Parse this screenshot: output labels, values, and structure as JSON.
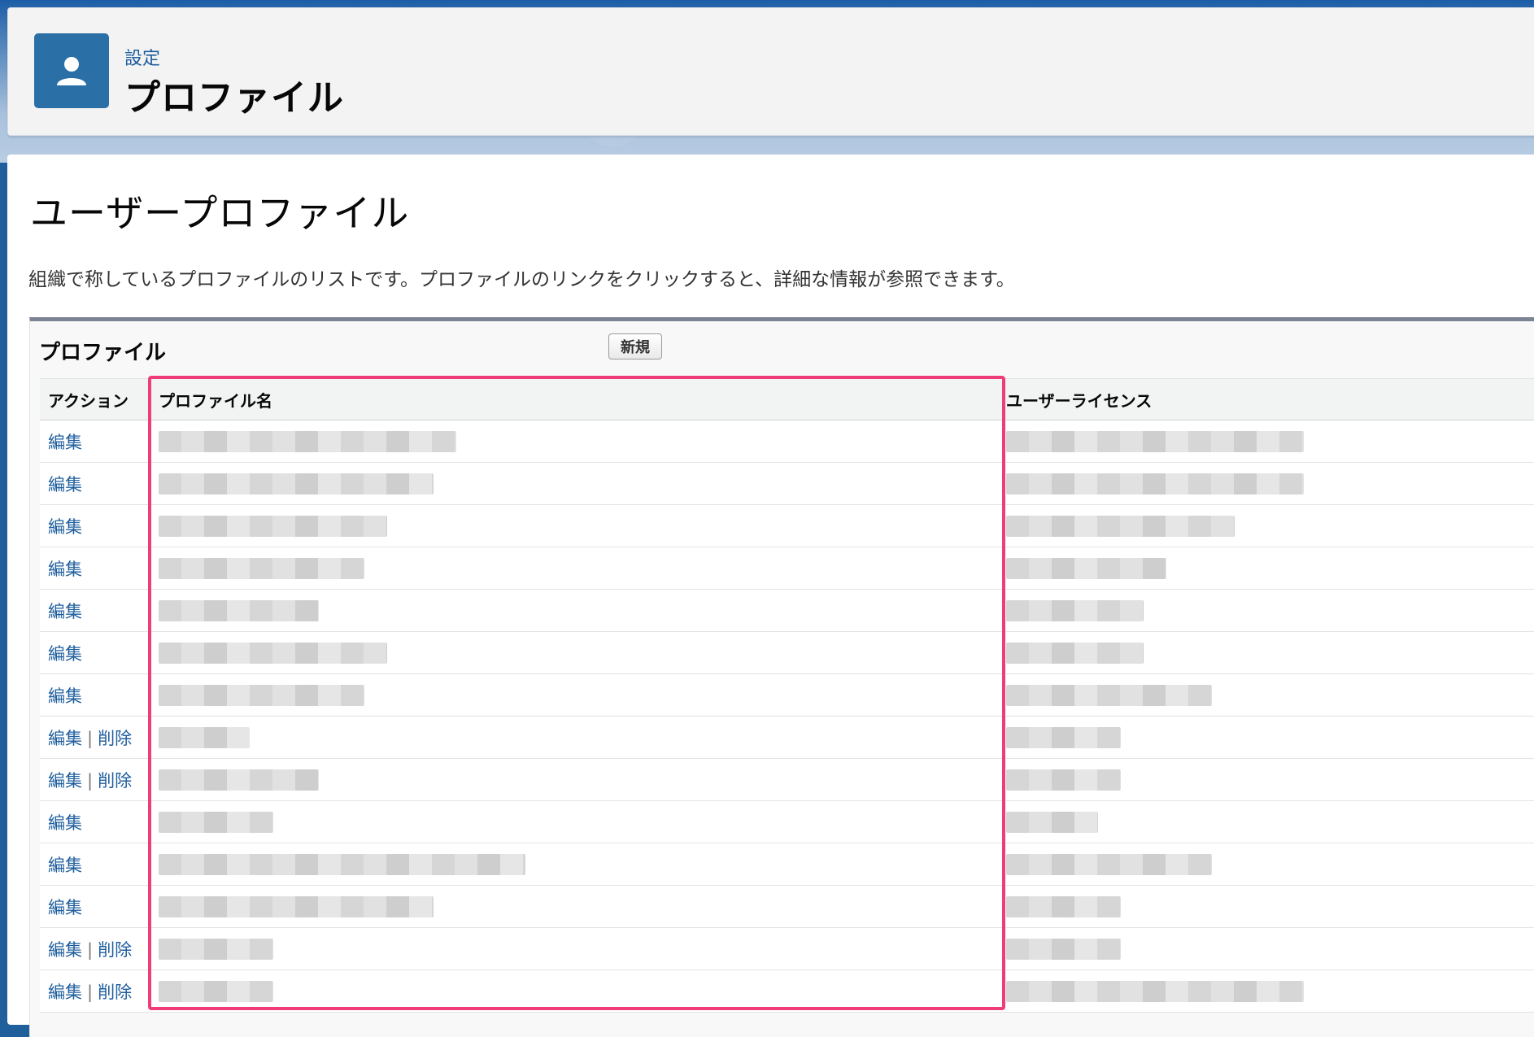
{
  "header": {
    "breadcrumb": "設定",
    "title": "プロファイル",
    "icon": "user-icon"
  },
  "main": {
    "heading": "ユーザープロファイル",
    "description": "組織で称しているプロファイルのリストです。プロファイルのリンクをクリックすると、詳細な情報が参照できます。"
  },
  "list": {
    "title": "プロファイル",
    "new_button": "新規",
    "columns": {
      "action": "アクション",
      "name": "プロファイル名",
      "license": "ユーザーライセンス"
    },
    "edit_label": "編集",
    "delete_label": "削除",
    "separator": "|",
    "rows": [
      {
        "deletable": false
      },
      {
        "deletable": false
      },
      {
        "deletable": false
      },
      {
        "deletable": false
      },
      {
        "deletable": false
      },
      {
        "deletable": false
      },
      {
        "deletable": false
      },
      {
        "deletable": true
      },
      {
        "deletable": true
      },
      {
        "deletable": false
      },
      {
        "deletable": false
      },
      {
        "deletable": false
      },
      {
        "deletable": true
      },
      {
        "deletable": true
      }
    ]
  },
  "colors": {
    "link": "#1e5e9e",
    "highlight": "#ef3d78",
    "icon_bg": "#2a6fa6"
  }
}
